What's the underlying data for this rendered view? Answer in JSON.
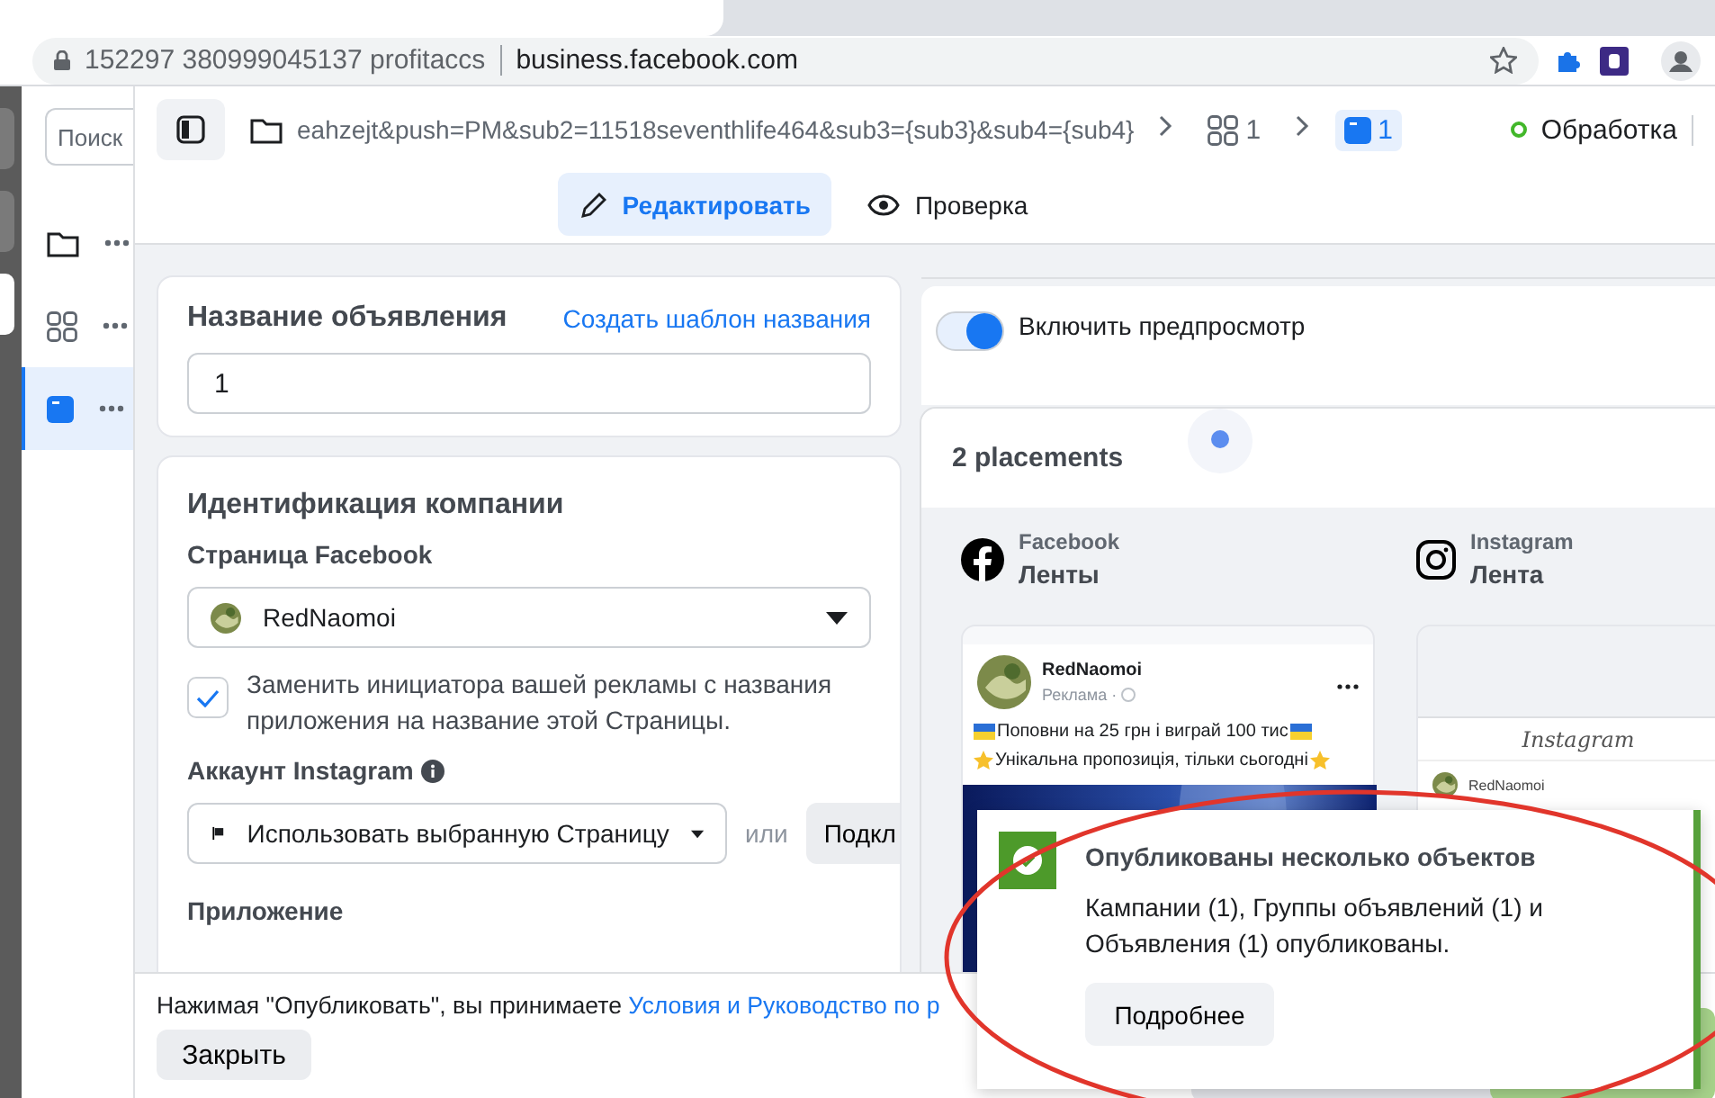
{
  "browser": {
    "owner": "152297 380999045137 profitaccs",
    "url": "business.facebook.com"
  },
  "sidebar": {
    "search_placeholder": "Поиск",
    "items": [
      {
        "kind": "folder",
        "selected": false
      },
      {
        "kind": "grid",
        "selected": false
      },
      {
        "kind": "ad",
        "selected": true
      }
    ]
  },
  "breadcrumb": {
    "path": "eahzejt&push=PM&sub2=11518seventhlife464&sub3={sub3}&sub4={sub4}",
    "steps": [
      {
        "kind": "grid",
        "label": "1",
        "selected": false
      },
      {
        "kind": "ad",
        "label": "1",
        "selected": true
      }
    ]
  },
  "status": {
    "label": "Обработка"
  },
  "mode_tabs": [
    {
      "kind": "edit",
      "label": "Редактировать",
      "selected": true
    },
    {
      "kind": "review",
      "label": "Проверка",
      "selected": false
    }
  ],
  "ad_name": {
    "title": "Название объявления",
    "link": "Создать шаблон названия",
    "value": "1"
  },
  "identity": {
    "title": "Идентификация компании",
    "page_label": "Страница Facebook",
    "page_value": "RedNaomoi",
    "replace_text": "Заменить инициатора вашей рекламы с названия приложения на название этой Страницы.",
    "replace_checked": true,
    "instagram_label": "Аккаунт Instagram",
    "instagram_value": "Использовать выбранную Страницу",
    "or": "или",
    "connect": "Подкл",
    "app_label": "Приложение"
  },
  "preview": {
    "toggle_label": "Включить предпросмотр",
    "on": true,
    "placements_title": "2 placements",
    "placements": [
      {
        "kind": "facebook",
        "platform": "Facebook",
        "name": "Ленты"
      },
      {
        "kind": "instagram",
        "platform": "Instagram",
        "name": "Лента"
      }
    ]
  },
  "fb_post": {
    "author": "RedNaomoi",
    "sponsored": "Реклама ·",
    "lines": [
      "Поповни на 25 грн і виграй 100 тис",
      "Унікальна пропозиція, тільки сьогодні"
    ]
  },
  "ig_post": {
    "logo": "Instagram",
    "author": "RedNaomoi"
  },
  "footer": {
    "text": "Нажимая \"Опубликовать\", вы принимаете ",
    "link": "Условия и Руководство по р",
    "close": "Закрыть"
  },
  "toast": {
    "title": "Опубликованы несколько объектов",
    "body": "Кампании (1), Группы объявлений (1) и Объявления (1) опубликованы.",
    "button": "Подробнее"
  }
}
